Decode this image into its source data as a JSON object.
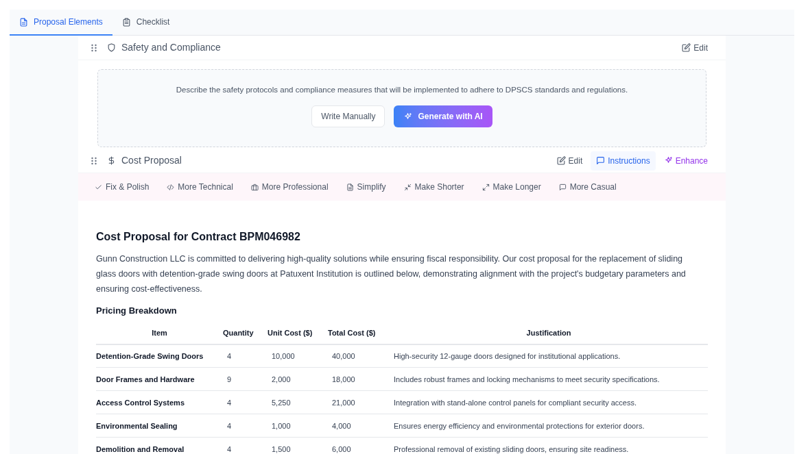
{
  "tabs": [
    {
      "label": "Proposal Elements",
      "selected": true
    },
    {
      "label": "Checklist",
      "selected": false
    }
  ],
  "sections": [
    {
      "title": "Safety and Compliance",
      "actions": [
        {
          "label": "Edit",
          "kind": "edit"
        }
      ],
      "prompt": {
        "description": "Describe the safety protocols and compliance measures that will be implemented to adhere to DPSCS standards and regulations.",
        "buttons": [
          {
            "label": "Write Manually",
            "kind": "secondary"
          },
          {
            "label": "Generate with AI",
            "kind": "ai"
          }
        ]
      }
    },
    {
      "title": "Cost Proposal",
      "actions": [
        {
          "label": "Edit",
          "kind": "edit"
        },
        {
          "label": "Instructions",
          "kind": "instructions"
        },
        {
          "label": "Enhance",
          "kind": "enhance"
        }
      ],
      "toolbar": [
        "Fix & Polish",
        "More Technical",
        "More Professional",
        "Simplify",
        "Make Shorter",
        "Make Longer",
        "More Casual"
      ],
      "content": {
        "heading": "Cost Proposal for Contract BPM046982",
        "paragraph": "Gunn Construction LLC is committed to delivering high-quality solutions while ensuring fiscal responsibility. Our cost proposal for the replacement of sliding glass doors with detention-grade swing doors at Patuxent Institution is outlined below, demonstrating alignment with the project's budgetary parameters and ensuring cost-effectiveness.",
        "subheading": "Pricing Breakdown",
        "table": {
          "columns": [
            "Item",
            "Quantity",
            "Unit Cost ($)",
            "Total Cost ($)",
            "Justification"
          ],
          "rows": [
            [
              "Detention-Grade Swing Doors",
              "4",
              "10,000",
              "40,000",
              "High-security 12-gauge doors designed for institutional applications."
            ],
            [
              "Door Frames and Hardware",
              "9",
              "2,000",
              "18,000",
              "Includes robust frames and locking mechanisms to meet security specifications."
            ],
            [
              "Access Control Systems",
              "4",
              "5,250",
              "21,000",
              "Integration with stand-alone control panels for compliant security access."
            ],
            [
              "Environmental Sealing",
              "4",
              "1,000",
              "4,000",
              "Ensures energy efficiency and environmental protections for exterior doors."
            ],
            [
              "Demolition and Removal",
              "4",
              "1,500",
              "6,000",
              "Professional removal of existing sliding doors, ensuring site readiness."
            ]
          ]
        }
      }
    }
  ]
}
